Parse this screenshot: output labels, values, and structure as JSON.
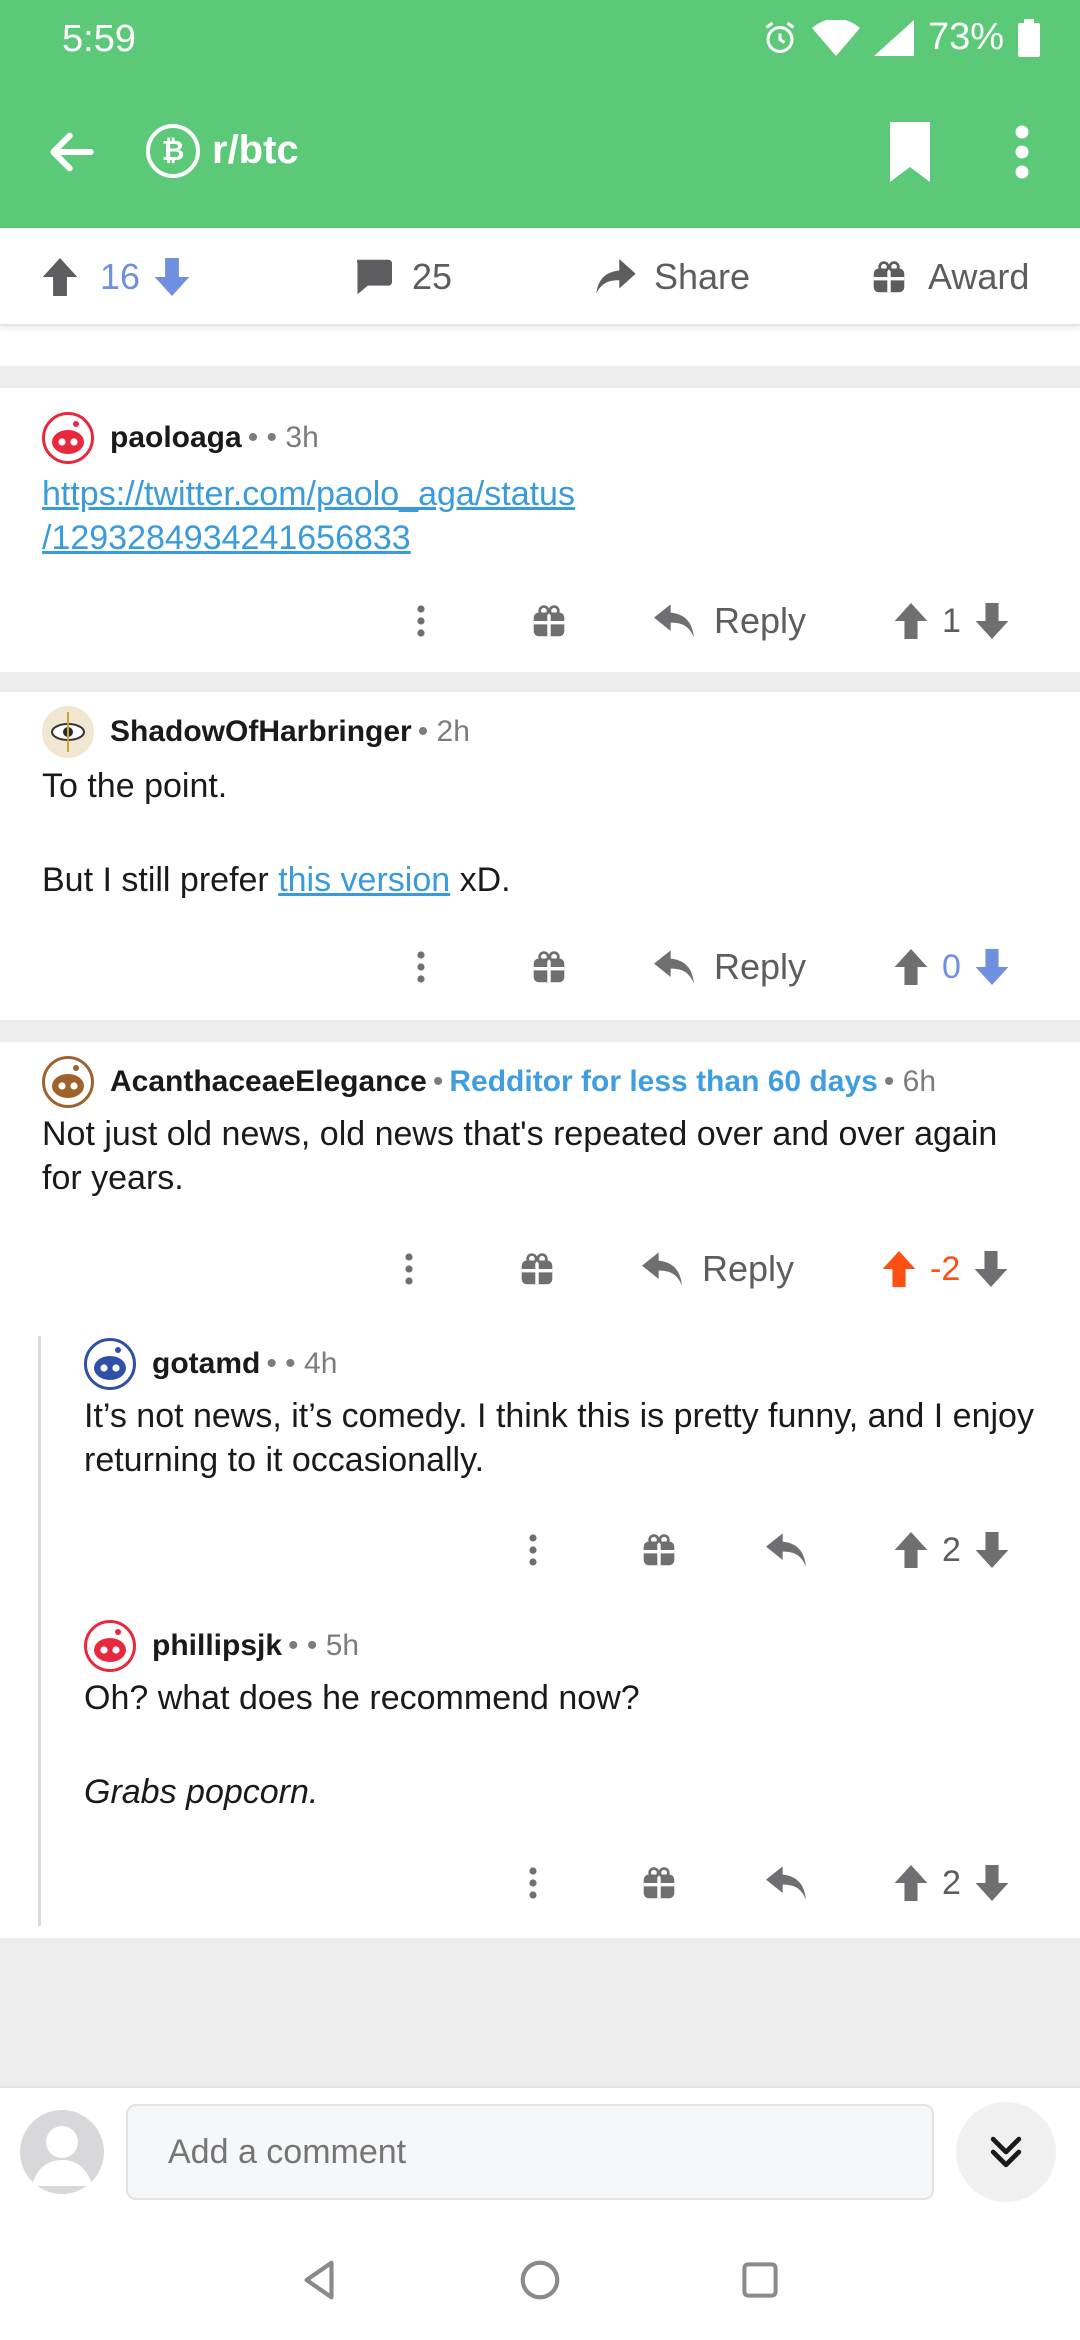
{
  "status": {
    "time": "5:59",
    "battery": "73%"
  },
  "header": {
    "subreddit": "r/btc",
    "sub_icon_glyph": "₿"
  },
  "post_actions": {
    "votes": "16",
    "comments": "25",
    "share_label": "Share",
    "award_label": "Award"
  },
  "colors": {
    "header_green": "#5cc978",
    "upvote_orange": "#fb4f14",
    "vote_blue": "#6f8fe0",
    "link_blue": "#3a9bdc"
  },
  "comments": [
    {
      "author": "paoloaga",
      "meta": "• • 3h",
      "link_line1": "https://twitter.com/paolo_aga/status",
      "link_line2": "/1293284934241656833",
      "reply_label": "Reply",
      "score": "1"
    },
    {
      "author": "ShadowOfHarbringer",
      "meta": "• 2h",
      "line1": "To the point.",
      "line2_prefix": "But I still prefer ",
      "line2_link": "this version",
      "line2_suffix": " xD.",
      "reply_label": "Reply",
      "score": "0"
    },
    {
      "author": "AcanthaceaeElegance",
      "sep1": "•",
      "flair": "Redditor for less than 60 days",
      "meta": "• 6h",
      "text": "Not just old news, old news that's repeated over and over again for years.",
      "reply_label": "Reply",
      "score": "-2"
    },
    {
      "author": "gotamd",
      "meta": "• • 4h",
      "text": "It’s not news, it’s comedy. I think this is pretty funny, and I enjoy returning to it occasionally.",
      "score": "2"
    },
    {
      "author": "phillipsjk",
      "meta": "• • 5h",
      "line1": "Oh? what does he recommend now?",
      "line2": "Grabs popcorn.",
      "score": "2"
    }
  ],
  "composer": {
    "placeholder": "Add a comment"
  }
}
